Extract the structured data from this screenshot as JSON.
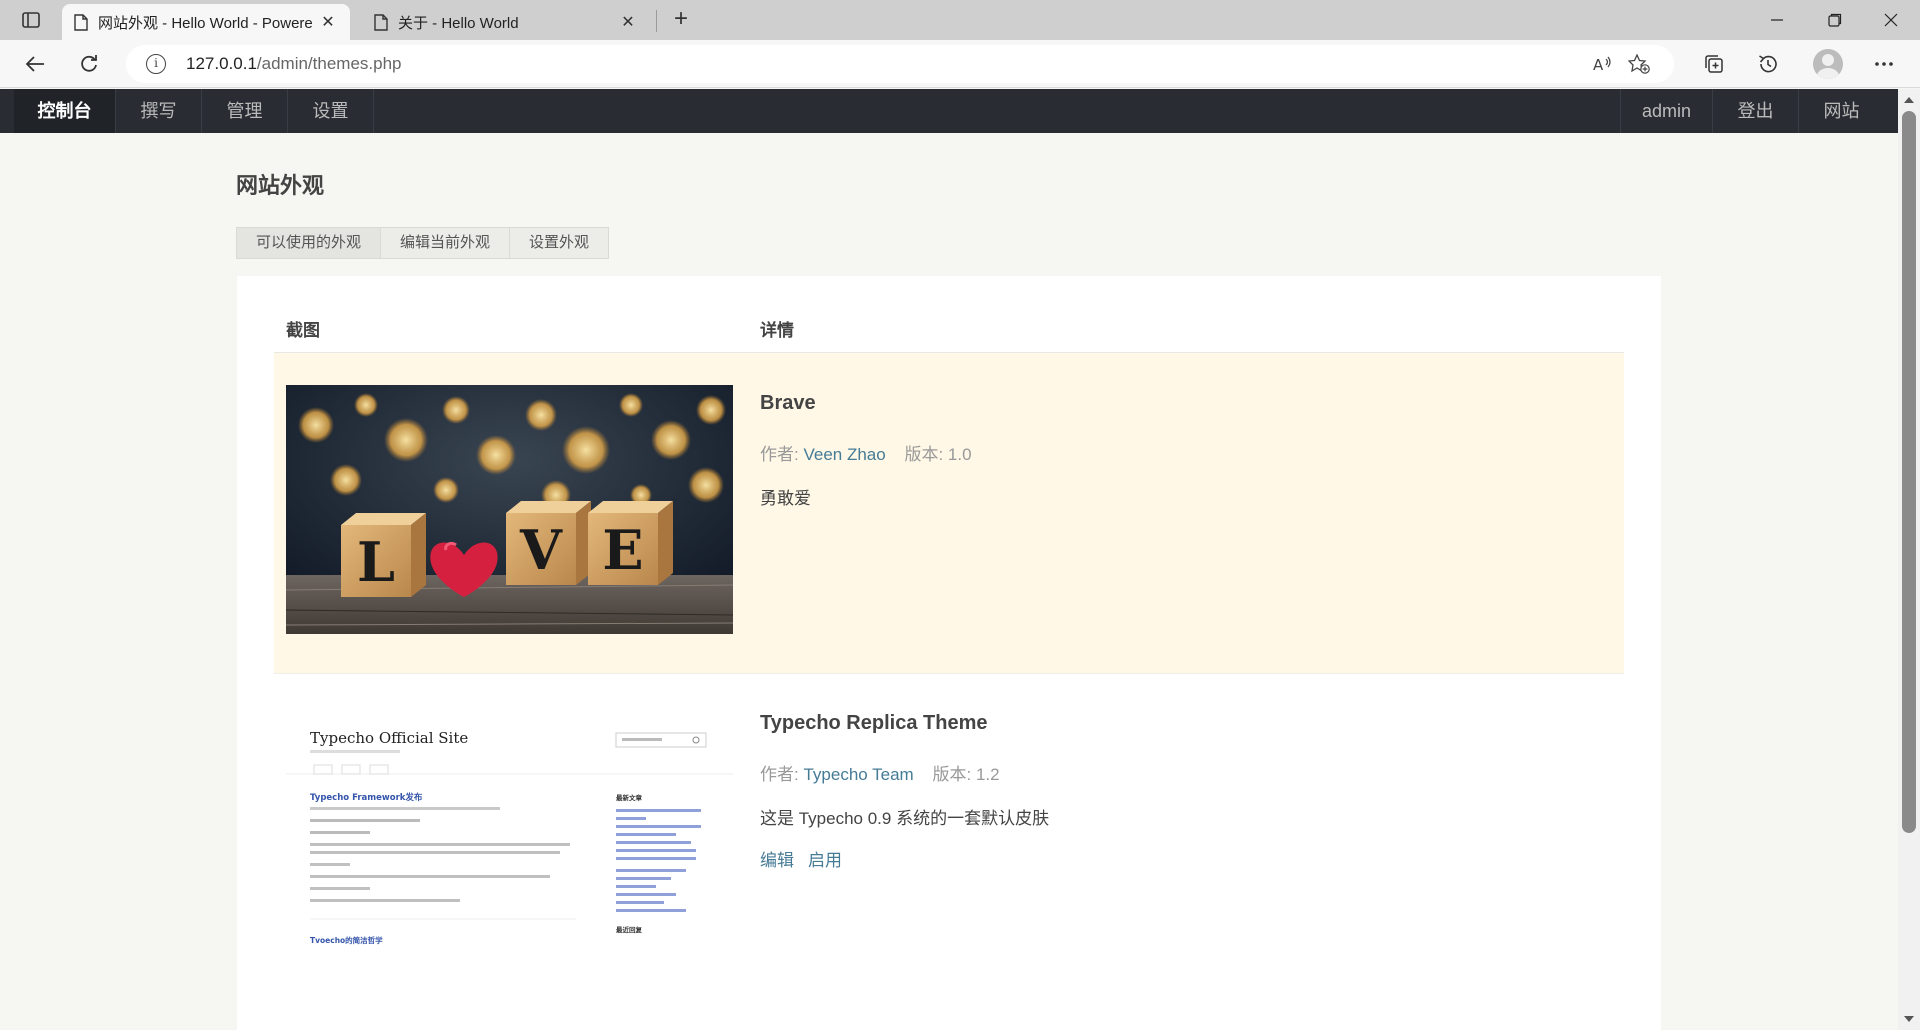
{
  "browser": {
    "tabs": [
      {
        "title": "网站外观 - Hello World - Powere",
        "active": true
      },
      {
        "title": "关于 - Hello World",
        "active": false
      }
    ],
    "url": {
      "host": "127.0.0.1",
      "path": "/admin/themes.php"
    }
  },
  "admin_nav": {
    "left": [
      "控制台",
      "撰写",
      "管理",
      "设置"
    ],
    "right": [
      "admin",
      "登出",
      "网站"
    ]
  },
  "page": {
    "title": "网站外观",
    "tabs": [
      "可以使用的外观",
      "编辑当前外观",
      "设置外观"
    ],
    "columns": {
      "screenshot": "截图",
      "details": "详情"
    }
  },
  "themes": [
    {
      "name": "Brave",
      "author_label": "作者:",
      "author": "Veen Zhao",
      "version_label": "版本:",
      "version": "1.0",
      "description": "勇敢爱",
      "actions": [],
      "active": true,
      "screenshot_letters": [
        "L",
        "V",
        "E"
      ]
    },
    {
      "name": "Typecho Replica Theme",
      "author_label": "作者:",
      "author": "Typecho Team",
      "version_label": "版本:",
      "version": "1.2",
      "description": "这是 Typecho 0.9 系统的一套默认皮肤",
      "actions": [
        "编辑",
        "启用"
      ],
      "active": false,
      "screenshot": {
        "site_title": "Typecho Official Site",
        "post_title": "Typecho Framework发布",
        "sidebar_heading": "最新文章",
        "footer_post_title": "Tvoecho的简洁哲学",
        "sidebar_bottom_heading": "最近回复"
      }
    }
  ],
  "colors": {
    "admin_bar": "#292d33",
    "link": "#467b96",
    "active_row": "#fff8e7"
  }
}
